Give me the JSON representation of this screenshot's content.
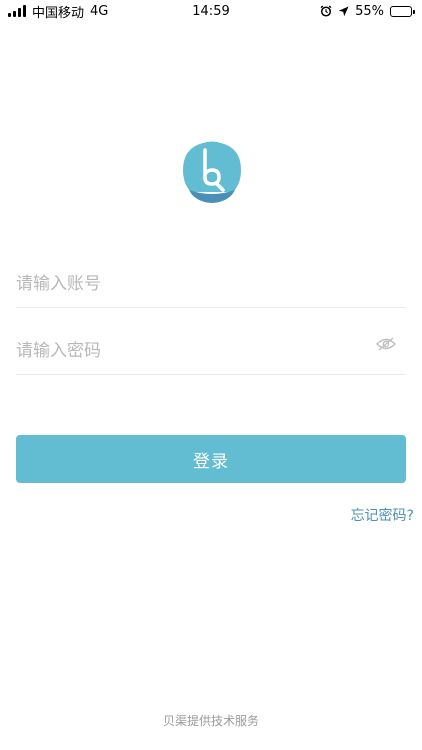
{
  "status_bar": {
    "carrier": "中国移动",
    "network": "4G",
    "time": "14:59",
    "battery": "55%",
    "battery_level": 0.55,
    "icons": [
      "signal-icon",
      "alarm-icon",
      "location-icon",
      "battery-icon"
    ]
  },
  "logo": {
    "icon": "app-logo-icon",
    "colors": {
      "main": "#63bdd2",
      "base": "#4a8fb8"
    }
  },
  "login_form": {
    "account_placeholder": "请输入账号",
    "password_placeholder": "请输入密码",
    "password_toggle_icon": "eye-icon",
    "login_label": "登录",
    "forgot_label": "忘记密码?"
  },
  "footer": {
    "text": "贝渠提供技术服务"
  },
  "colors": {
    "accent": "#63bdd2",
    "link": "#4a90b8",
    "placeholder": "#b8b8b8",
    "divider": "#ececec"
  }
}
